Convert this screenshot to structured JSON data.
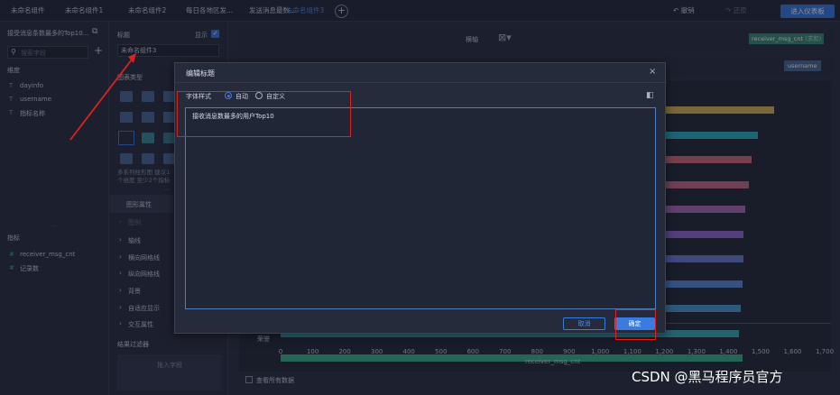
{
  "tabs": [
    {
      "label": "未命名组件",
      "active": false
    },
    {
      "label": "未命名组件1",
      "active": false
    },
    {
      "label": "未命名组件2",
      "active": false
    },
    {
      "label": "每日各地区发...",
      "active": false
    },
    {
      "label": "发送消息最数...",
      "active": false
    },
    {
      "label": "未命名组件3",
      "active": true
    }
  ],
  "toolbar": {
    "add_tab": "+",
    "undo": "撤销",
    "redo": "还原",
    "enter_dashboard": "进入仪表板"
  },
  "left_panel": {
    "dataset_name": "接受消息条数最多的Top10...",
    "search_placeholder": "搜索字段",
    "add": "+",
    "dimension_header": "维度",
    "dimensions": [
      "dayinfo",
      "username",
      "指标名称"
    ],
    "measure_header": "指标",
    "measures": [
      "receiver_msg_cnt",
      "记录数"
    ]
  },
  "mid_panel": {
    "title_label": "标题",
    "show_label": "显示",
    "title_value": "未命名组件3",
    "chart_type_label": "图表类型",
    "chart_type_hint": "多系列柱形图 建议1个维度 至少2个指标",
    "graph_property": "图形属性",
    "legend": "图例",
    "property_items": [
      "轴线",
      "横向网格线",
      "纵向网格线",
      "背景",
      "自适应显示",
      "交互属性"
    ],
    "result_filter": "结果过滤器",
    "drop_field": "拖入字段"
  },
  "canvas": {
    "horizontal": "横轴",
    "x_field_tag": "receiver_msg_cnt",
    "x_field_tag_suffix": "(求和)",
    "y_field_tag": "username",
    "view_all_data": "查看所有数据",
    "last_category_label": "荣誉"
  },
  "chart_data": {
    "type": "bar",
    "orientation": "horizontal",
    "xlabel": "receiver_msg_cnt",
    "x_ticks": [
      "0",
      "100",
      "200",
      "300",
      "400",
      "500",
      "600",
      "700",
      "800",
      "900",
      "1,000",
      "1,100",
      "1,200",
      "1,300",
      "1,400",
      "1,500",
      "1,600",
      "1,700"
    ],
    "xlim": [
      0,
      1700
    ],
    "values": [
      1540,
      1490,
      1470,
      1460,
      1450,
      1445,
      1445,
      1440,
      1435,
      1430,
      1440
    ],
    "colors": [
      "#d6b35a",
      "#2bb0c4",
      "#d06a7a",
      "#c46a86",
      "#a86ab8",
      "#8c6ad0",
      "#6a7ad8",
      "#5a8ad8",
      "#4a9ad0",
      "#3aaab8",
      "#3ab08a"
    ]
  },
  "dialog": {
    "title": "编辑标题",
    "close": "×",
    "font_style_label": "字体样式",
    "option_auto": "自动",
    "option_custom": "自定义",
    "text": "接收消息数最多的用户Top10",
    "cancel": "取消",
    "confirm": "确定"
  },
  "watermark": "CSDN @黑马程序员官方"
}
